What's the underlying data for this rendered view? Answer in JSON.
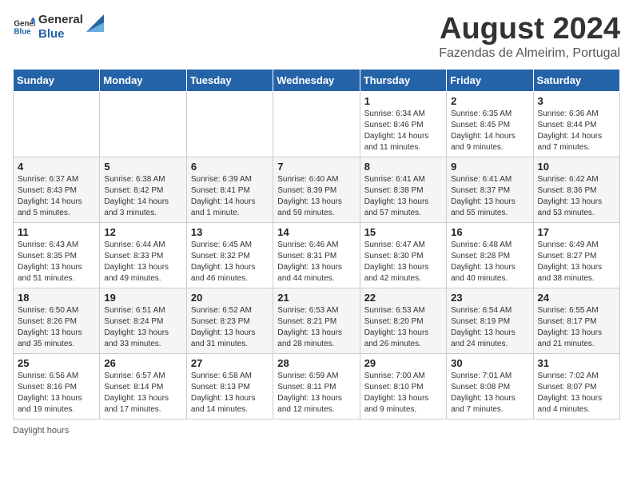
{
  "header": {
    "logo_line1": "General",
    "logo_line2": "Blue",
    "month": "August 2024",
    "location": "Fazendas de Almeirim, Portugal"
  },
  "days_of_week": [
    "Sunday",
    "Monday",
    "Tuesday",
    "Wednesday",
    "Thursday",
    "Friday",
    "Saturday"
  ],
  "weeks": [
    [
      {
        "day": "",
        "info": ""
      },
      {
        "day": "",
        "info": ""
      },
      {
        "day": "",
        "info": ""
      },
      {
        "day": "",
        "info": ""
      },
      {
        "day": "1",
        "info": "Sunrise: 6:34 AM\nSunset: 8:46 PM\nDaylight: 14 hours\nand 11 minutes."
      },
      {
        "day": "2",
        "info": "Sunrise: 6:35 AM\nSunset: 8:45 PM\nDaylight: 14 hours\nand 9 minutes."
      },
      {
        "day": "3",
        "info": "Sunrise: 6:36 AM\nSunset: 8:44 PM\nDaylight: 14 hours\nand 7 minutes."
      }
    ],
    [
      {
        "day": "4",
        "info": "Sunrise: 6:37 AM\nSunset: 8:43 PM\nDaylight: 14 hours\nand 5 minutes."
      },
      {
        "day": "5",
        "info": "Sunrise: 6:38 AM\nSunset: 8:42 PM\nDaylight: 14 hours\nand 3 minutes."
      },
      {
        "day": "6",
        "info": "Sunrise: 6:39 AM\nSunset: 8:41 PM\nDaylight: 14 hours\nand 1 minute."
      },
      {
        "day": "7",
        "info": "Sunrise: 6:40 AM\nSunset: 8:39 PM\nDaylight: 13 hours\nand 59 minutes."
      },
      {
        "day": "8",
        "info": "Sunrise: 6:41 AM\nSunset: 8:38 PM\nDaylight: 13 hours\nand 57 minutes."
      },
      {
        "day": "9",
        "info": "Sunrise: 6:41 AM\nSunset: 8:37 PM\nDaylight: 13 hours\nand 55 minutes."
      },
      {
        "day": "10",
        "info": "Sunrise: 6:42 AM\nSunset: 8:36 PM\nDaylight: 13 hours\nand 53 minutes."
      }
    ],
    [
      {
        "day": "11",
        "info": "Sunrise: 6:43 AM\nSunset: 8:35 PM\nDaylight: 13 hours\nand 51 minutes."
      },
      {
        "day": "12",
        "info": "Sunrise: 6:44 AM\nSunset: 8:33 PM\nDaylight: 13 hours\nand 49 minutes."
      },
      {
        "day": "13",
        "info": "Sunrise: 6:45 AM\nSunset: 8:32 PM\nDaylight: 13 hours\nand 46 minutes."
      },
      {
        "day": "14",
        "info": "Sunrise: 6:46 AM\nSunset: 8:31 PM\nDaylight: 13 hours\nand 44 minutes."
      },
      {
        "day": "15",
        "info": "Sunrise: 6:47 AM\nSunset: 8:30 PM\nDaylight: 13 hours\nand 42 minutes."
      },
      {
        "day": "16",
        "info": "Sunrise: 6:48 AM\nSunset: 8:28 PM\nDaylight: 13 hours\nand 40 minutes."
      },
      {
        "day": "17",
        "info": "Sunrise: 6:49 AM\nSunset: 8:27 PM\nDaylight: 13 hours\nand 38 minutes."
      }
    ],
    [
      {
        "day": "18",
        "info": "Sunrise: 6:50 AM\nSunset: 8:26 PM\nDaylight: 13 hours\nand 35 minutes."
      },
      {
        "day": "19",
        "info": "Sunrise: 6:51 AM\nSunset: 8:24 PM\nDaylight: 13 hours\nand 33 minutes."
      },
      {
        "day": "20",
        "info": "Sunrise: 6:52 AM\nSunset: 8:23 PM\nDaylight: 13 hours\nand 31 minutes."
      },
      {
        "day": "21",
        "info": "Sunrise: 6:53 AM\nSunset: 8:21 PM\nDaylight: 13 hours\nand 28 minutes."
      },
      {
        "day": "22",
        "info": "Sunrise: 6:53 AM\nSunset: 8:20 PM\nDaylight: 13 hours\nand 26 minutes."
      },
      {
        "day": "23",
        "info": "Sunrise: 6:54 AM\nSunset: 8:19 PM\nDaylight: 13 hours\nand 24 minutes."
      },
      {
        "day": "24",
        "info": "Sunrise: 6:55 AM\nSunset: 8:17 PM\nDaylight: 13 hours\nand 21 minutes."
      }
    ],
    [
      {
        "day": "25",
        "info": "Sunrise: 6:56 AM\nSunset: 8:16 PM\nDaylight: 13 hours\nand 19 minutes."
      },
      {
        "day": "26",
        "info": "Sunrise: 6:57 AM\nSunset: 8:14 PM\nDaylight: 13 hours\nand 17 minutes."
      },
      {
        "day": "27",
        "info": "Sunrise: 6:58 AM\nSunset: 8:13 PM\nDaylight: 13 hours\nand 14 minutes."
      },
      {
        "day": "28",
        "info": "Sunrise: 6:59 AM\nSunset: 8:11 PM\nDaylight: 13 hours\nand 12 minutes."
      },
      {
        "day": "29",
        "info": "Sunrise: 7:00 AM\nSunset: 8:10 PM\nDaylight: 13 hours\nand 9 minutes."
      },
      {
        "day": "30",
        "info": "Sunrise: 7:01 AM\nSunset: 8:08 PM\nDaylight: 13 hours\nand 7 minutes."
      },
      {
        "day": "31",
        "info": "Sunrise: 7:02 AM\nSunset: 8:07 PM\nDaylight: 13 hours\nand 4 minutes."
      }
    ]
  ],
  "footer": "Daylight hours"
}
